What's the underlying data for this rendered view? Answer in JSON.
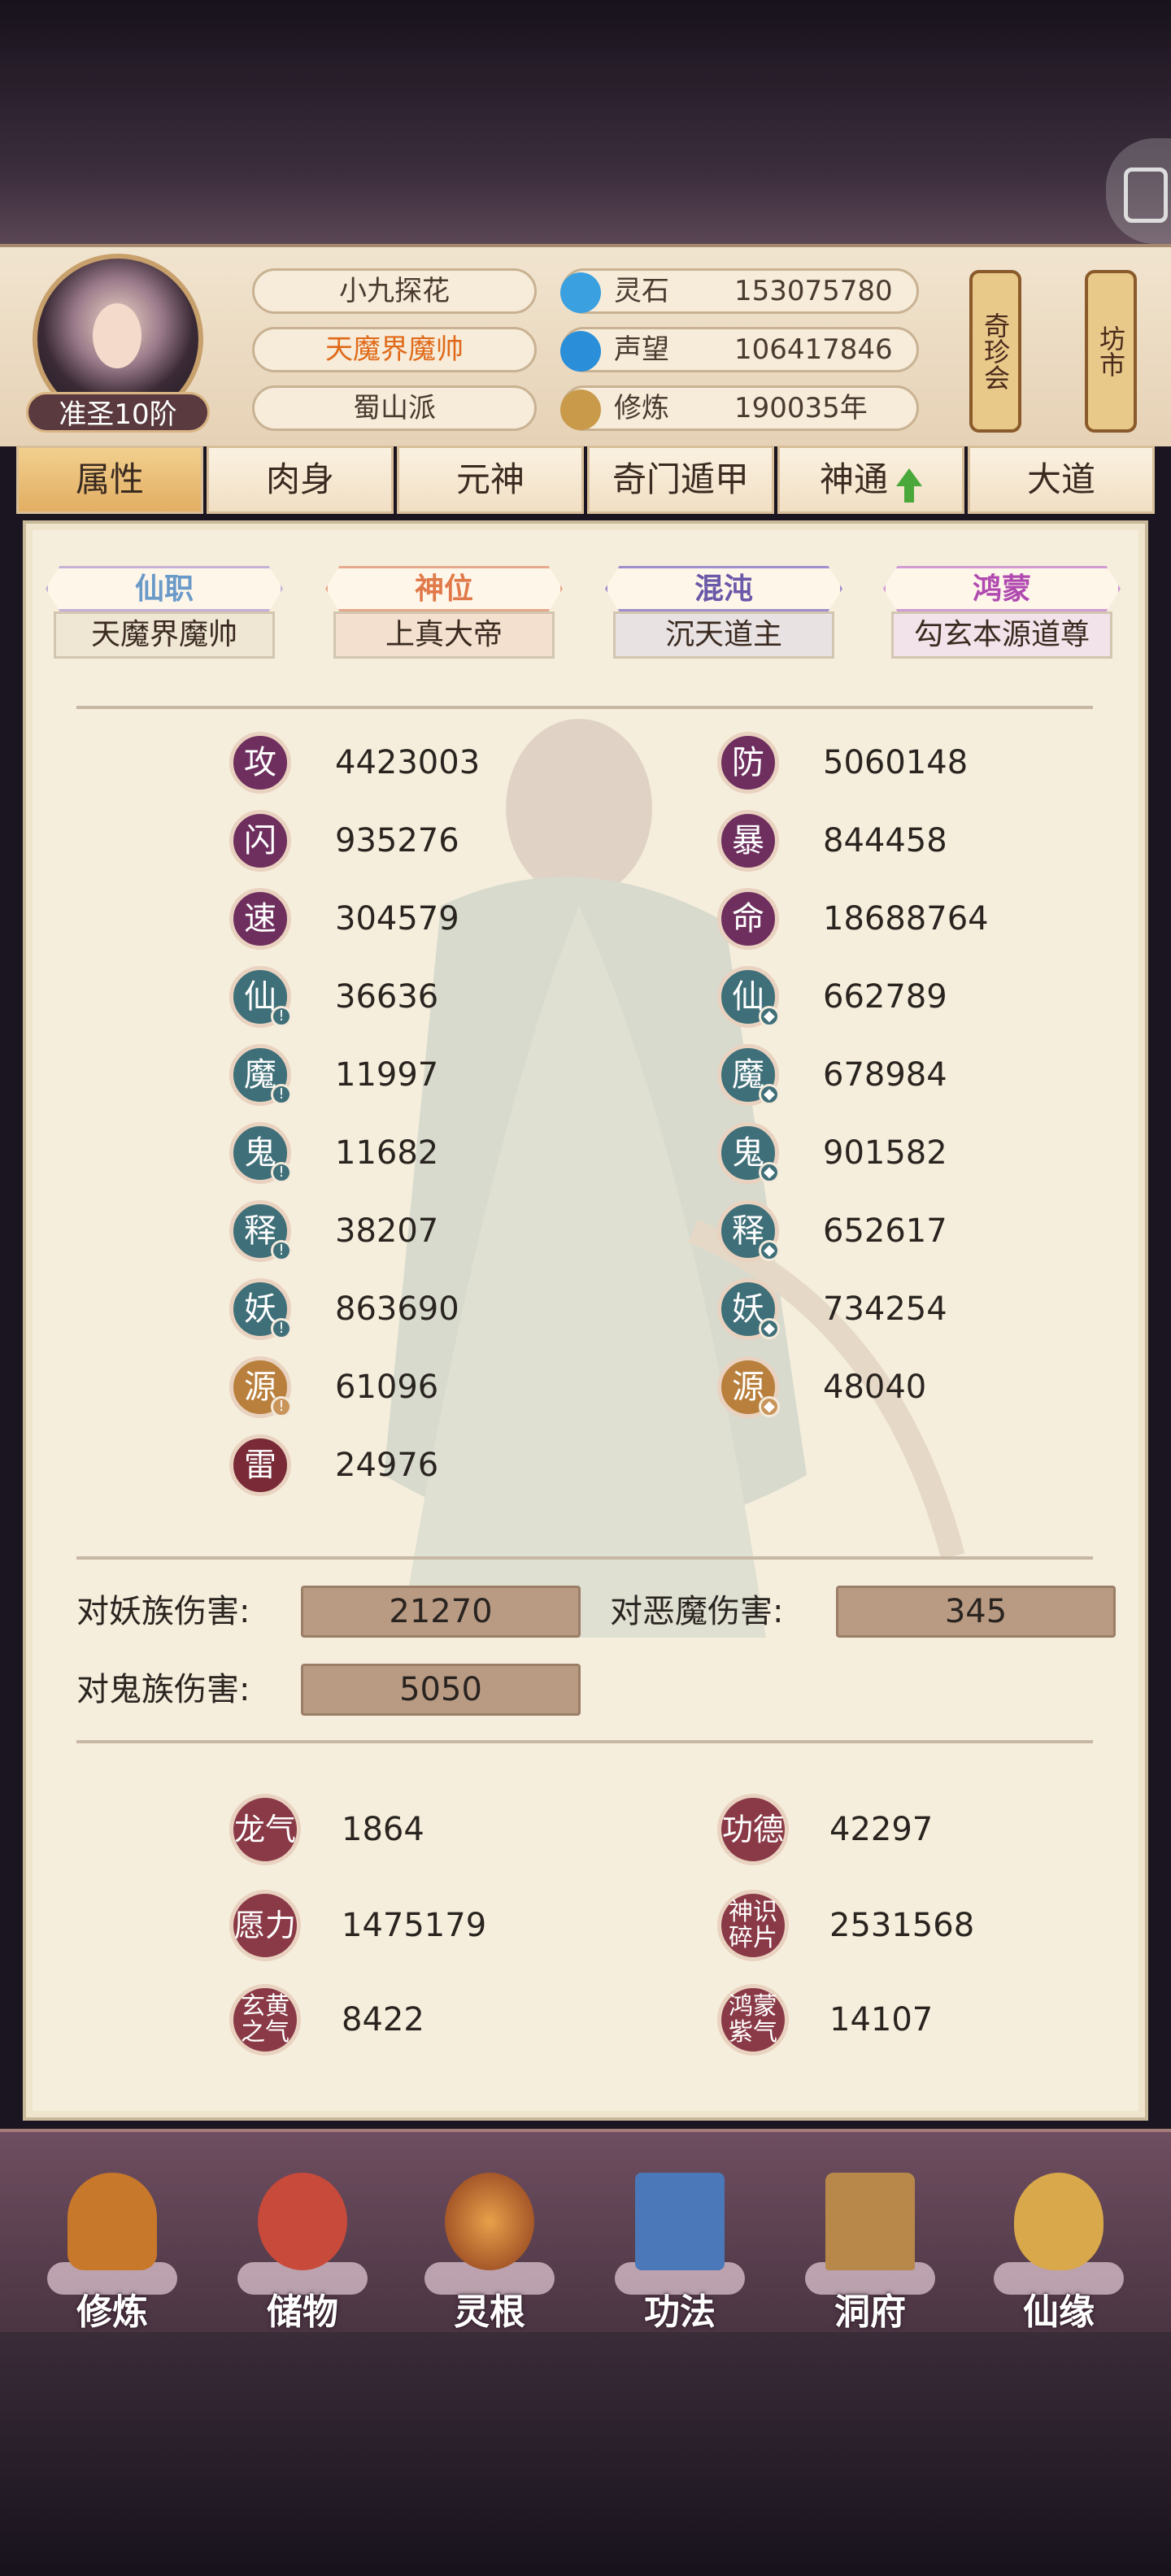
{
  "header": {
    "rank": "准圣10阶",
    "name": "小九探花",
    "title": "天魔界魔帅",
    "sect": "蜀山派",
    "resources": [
      {
        "icon": "spirit-stone-icon",
        "label": "灵石",
        "value": "153075780",
        "color": "#3aa0e0"
      },
      {
        "icon": "reputation-icon",
        "label": "声望",
        "value": "106417846",
        "color": "#2a8fd8"
      },
      {
        "icon": "cultivation-icon",
        "label": "修炼",
        "value": "190035年",
        "color": "#c89a4a"
      }
    ],
    "side_buttons": [
      "奇珍会",
      "坊市"
    ]
  },
  "tabs": [
    {
      "label": "属性",
      "active": true
    },
    {
      "label": "肉身",
      "active": false
    },
    {
      "label": "元神",
      "active": false
    },
    {
      "label": "奇门遁甲",
      "active": false
    },
    {
      "label": "神通",
      "active": false,
      "arrow": "up-arrow-icon"
    },
    {
      "label": "大道",
      "active": false
    }
  ],
  "titles": [
    {
      "name": "仙职",
      "value": "天魔界魔帅",
      "color": "#6a9ac8"
    },
    {
      "name": "神位",
      "value": "上真大帝",
      "color": "#e07a4a"
    },
    {
      "name": "混沌",
      "value": "沉天道主",
      "color": "#6a58a8"
    },
    {
      "name": "鸿蒙",
      "value": "勾玄本源道尊",
      "color": "#b04ab0"
    }
  ],
  "stats_left": [
    {
      "label": "攻",
      "value": "4423003",
      "color": "purple"
    },
    {
      "label": "闪",
      "value": "935276",
      "color": "purple"
    },
    {
      "label": "速",
      "value": "304579",
      "color": "purple"
    },
    {
      "label": "仙",
      "value": "36636",
      "color": "teal"
    },
    {
      "label": "魔",
      "value": "11997",
      "color": "teal"
    },
    {
      "label": "鬼",
      "value": "11682",
      "color": "teal"
    },
    {
      "label": "释",
      "value": "38207",
      "color": "teal"
    },
    {
      "label": "妖",
      "value": "863690",
      "color": "teal"
    },
    {
      "label": "源",
      "value": "61096",
      "color": "gold"
    },
    {
      "label": "雷",
      "value": "24976",
      "color": "red"
    }
  ],
  "stats_right": [
    {
      "label": "防",
      "value": "5060148",
      "color": "purple"
    },
    {
      "label": "暴",
      "value": "844458",
      "color": "purple"
    },
    {
      "label": "命",
      "value": "18688764",
      "color": "purple"
    },
    {
      "label": "仙",
      "value": "662789",
      "color": "teal"
    },
    {
      "label": "魔",
      "value": "678984",
      "color": "teal"
    },
    {
      "label": "鬼",
      "value": "901582",
      "color": "teal"
    },
    {
      "label": "释",
      "value": "652617",
      "color": "teal"
    },
    {
      "label": "妖",
      "value": "734254",
      "color": "teal"
    },
    {
      "label": "源",
      "value": "48040",
      "color": "gold"
    }
  ],
  "damage": [
    {
      "label": "对妖族伤害:",
      "value": "21270"
    },
    {
      "label": "对恶魔伤害:",
      "value": "345"
    },
    {
      "label": "对鬼族伤害:",
      "value": "5050"
    }
  ],
  "misc": [
    {
      "label": "龙气",
      "value": "1864"
    },
    {
      "label": "功德",
      "value": "42297"
    },
    {
      "label": "愿力",
      "value": "1475179"
    },
    {
      "label": "神识碎片",
      "value": "2531568"
    },
    {
      "label": "玄黄之气",
      "value": "8422"
    },
    {
      "label": "鸿蒙紫气",
      "value": "14107"
    }
  ],
  "bottom_nav": [
    {
      "label": "修炼",
      "icon": "meditation-icon",
      "color": "#c8782a"
    },
    {
      "label": "储物",
      "icon": "bag-icon",
      "color": "#c84a3a"
    },
    {
      "label": "灵根",
      "icon": "spirit-root-icon",
      "color": "#b8582a"
    },
    {
      "label": "功法",
      "icon": "book-icon",
      "color": "#4a78b8"
    },
    {
      "label": "洞府",
      "icon": "cave-house-icon",
      "color": "#b8884a"
    },
    {
      "label": "仙缘",
      "icon": "gourd-icon",
      "color": "#d8a84a"
    }
  ]
}
